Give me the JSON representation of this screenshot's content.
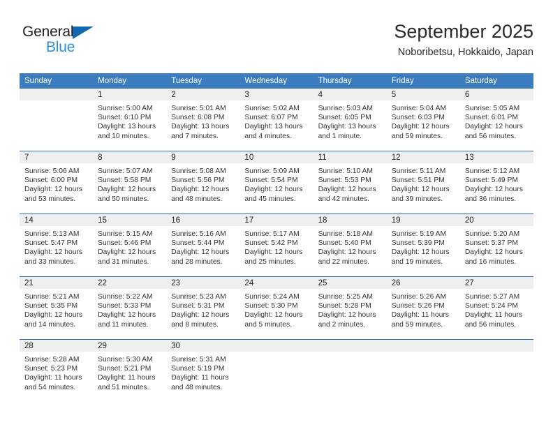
{
  "logo": {
    "word_top": "General",
    "word_bottom": "Blue",
    "triangle_color": "#1269b0",
    "bottom_color": "#2e8fd6"
  },
  "header": {
    "title": "September 2025",
    "subtitle": "Noboribetsu, Hokkaido, Japan"
  },
  "theme": {
    "header_bg": "#3a7cbd",
    "header_text": "#ffffff",
    "daynum_band_bg": "#efefef",
    "row_divider": "#2c6ca8"
  },
  "weekday_headers": [
    "Sunday",
    "Monday",
    "Tuesday",
    "Wednesday",
    "Thursday",
    "Friday",
    "Saturday"
  ],
  "weeks": [
    [
      {
        "day": "",
        "sunrise": "",
        "sunset": "",
        "daylight_l1": "",
        "daylight_l2": ""
      },
      {
        "day": "1",
        "sunrise": "Sunrise: 5:00 AM",
        "sunset": "Sunset: 6:10 PM",
        "daylight_l1": "Daylight: 13 hours",
        "daylight_l2": "and 10 minutes."
      },
      {
        "day": "2",
        "sunrise": "Sunrise: 5:01 AM",
        "sunset": "Sunset: 6:08 PM",
        "daylight_l1": "Daylight: 13 hours",
        "daylight_l2": "and 7 minutes."
      },
      {
        "day": "3",
        "sunrise": "Sunrise: 5:02 AM",
        "sunset": "Sunset: 6:07 PM",
        "daylight_l1": "Daylight: 13 hours",
        "daylight_l2": "and 4 minutes."
      },
      {
        "day": "4",
        "sunrise": "Sunrise: 5:03 AM",
        "sunset": "Sunset: 6:05 PM",
        "daylight_l1": "Daylight: 13 hours",
        "daylight_l2": "and 1 minute."
      },
      {
        "day": "5",
        "sunrise": "Sunrise: 5:04 AM",
        "sunset": "Sunset: 6:03 PM",
        "daylight_l1": "Daylight: 12 hours",
        "daylight_l2": "and 59 minutes."
      },
      {
        "day": "6",
        "sunrise": "Sunrise: 5:05 AM",
        "sunset": "Sunset: 6:01 PM",
        "daylight_l1": "Daylight: 12 hours",
        "daylight_l2": "and 56 minutes."
      }
    ],
    [
      {
        "day": "7",
        "sunrise": "Sunrise: 5:06 AM",
        "sunset": "Sunset: 6:00 PM",
        "daylight_l1": "Daylight: 12 hours",
        "daylight_l2": "and 53 minutes."
      },
      {
        "day": "8",
        "sunrise": "Sunrise: 5:07 AM",
        "sunset": "Sunset: 5:58 PM",
        "daylight_l1": "Daylight: 12 hours",
        "daylight_l2": "and 50 minutes."
      },
      {
        "day": "9",
        "sunrise": "Sunrise: 5:08 AM",
        "sunset": "Sunset: 5:56 PM",
        "daylight_l1": "Daylight: 12 hours",
        "daylight_l2": "and 48 minutes."
      },
      {
        "day": "10",
        "sunrise": "Sunrise: 5:09 AM",
        "sunset": "Sunset: 5:54 PM",
        "daylight_l1": "Daylight: 12 hours",
        "daylight_l2": "and 45 minutes."
      },
      {
        "day": "11",
        "sunrise": "Sunrise: 5:10 AM",
        "sunset": "Sunset: 5:53 PM",
        "daylight_l1": "Daylight: 12 hours",
        "daylight_l2": "and 42 minutes."
      },
      {
        "day": "12",
        "sunrise": "Sunrise: 5:11 AM",
        "sunset": "Sunset: 5:51 PM",
        "daylight_l1": "Daylight: 12 hours",
        "daylight_l2": "and 39 minutes."
      },
      {
        "day": "13",
        "sunrise": "Sunrise: 5:12 AM",
        "sunset": "Sunset: 5:49 PM",
        "daylight_l1": "Daylight: 12 hours",
        "daylight_l2": "and 36 minutes."
      }
    ],
    [
      {
        "day": "14",
        "sunrise": "Sunrise: 5:13 AM",
        "sunset": "Sunset: 5:47 PM",
        "daylight_l1": "Daylight: 12 hours",
        "daylight_l2": "and 33 minutes."
      },
      {
        "day": "15",
        "sunrise": "Sunrise: 5:15 AM",
        "sunset": "Sunset: 5:46 PM",
        "daylight_l1": "Daylight: 12 hours",
        "daylight_l2": "and 31 minutes."
      },
      {
        "day": "16",
        "sunrise": "Sunrise: 5:16 AM",
        "sunset": "Sunset: 5:44 PM",
        "daylight_l1": "Daylight: 12 hours",
        "daylight_l2": "and 28 minutes."
      },
      {
        "day": "17",
        "sunrise": "Sunrise: 5:17 AM",
        "sunset": "Sunset: 5:42 PM",
        "daylight_l1": "Daylight: 12 hours",
        "daylight_l2": "and 25 minutes."
      },
      {
        "day": "18",
        "sunrise": "Sunrise: 5:18 AM",
        "sunset": "Sunset: 5:40 PM",
        "daylight_l1": "Daylight: 12 hours",
        "daylight_l2": "and 22 minutes."
      },
      {
        "day": "19",
        "sunrise": "Sunrise: 5:19 AM",
        "sunset": "Sunset: 5:39 PM",
        "daylight_l1": "Daylight: 12 hours",
        "daylight_l2": "and 19 minutes."
      },
      {
        "day": "20",
        "sunrise": "Sunrise: 5:20 AM",
        "sunset": "Sunset: 5:37 PM",
        "daylight_l1": "Daylight: 12 hours",
        "daylight_l2": "and 16 minutes."
      }
    ],
    [
      {
        "day": "21",
        "sunrise": "Sunrise: 5:21 AM",
        "sunset": "Sunset: 5:35 PM",
        "daylight_l1": "Daylight: 12 hours",
        "daylight_l2": "and 14 minutes."
      },
      {
        "day": "22",
        "sunrise": "Sunrise: 5:22 AM",
        "sunset": "Sunset: 5:33 PM",
        "daylight_l1": "Daylight: 12 hours",
        "daylight_l2": "and 11 minutes."
      },
      {
        "day": "23",
        "sunrise": "Sunrise: 5:23 AM",
        "sunset": "Sunset: 5:31 PM",
        "daylight_l1": "Daylight: 12 hours",
        "daylight_l2": "and 8 minutes."
      },
      {
        "day": "24",
        "sunrise": "Sunrise: 5:24 AM",
        "sunset": "Sunset: 5:30 PM",
        "daylight_l1": "Daylight: 12 hours",
        "daylight_l2": "and 5 minutes."
      },
      {
        "day": "25",
        "sunrise": "Sunrise: 5:25 AM",
        "sunset": "Sunset: 5:28 PM",
        "daylight_l1": "Daylight: 12 hours",
        "daylight_l2": "and 2 minutes."
      },
      {
        "day": "26",
        "sunrise": "Sunrise: 5:26 AM",
        "sunset": "Sunset: 5:26 PM",
        "daylight_l1": "Daylight: 11 hours",
        "daylight_l2": "and 59 minutes."
      },
      {
        "day": "27",
        "sunrise": "Sunrise: 5:27 AM",
        "sunset": "Sunset: 5:24 PM",
        "daylight_l1": "Daylight: 11 hours",
        "daylight_l2": "and 56 minutes."
      }
    ],
    [
      {
        "day": "28",
        "sunrise": "Sunrise: 5:28 AM",
        "sunset": "Sunset: 5:23 PM",
        "daylight_l1": "Daylight: 11 hours",
        "daylight_l2": "and 54 minutes."
      },
      {
        "day": "29",
        "sunrise": "Sunrise: 5:30 AM",
        "sunset": "Sunset: 5:21 PM",
        "daylight_l1": "Daylight: 11 hours",
        "daylight_l2": "and 51 minutes."
      },
      {
        "day": "30",
        "sunrise": "Sunrise: 5:31 AM",
        "sunset": "Sunset: 5:19 PM",
        "daylight_l1": "Daylight: 11 hours",
        "daylight_l2": "and 48 minutes."
      },
      {
        "day": "",
        "sunrise": "",
        "sunset": "",
        "daylight_l1": "",
        "daylight_l2": ""
      },
      {
        "day": "",
        "sunrise": "",
        "sunset": "",
        "daylight_l1": "",
        "daylight_l2": ""
      },
      {
        "day": "",
        "sunrise": "",
        "sunset": "",
        "daylight_l1": "",
        "daylight_l2": ""
      },
      {
        "day": "",
        "sunrise": "",
        "sunset": "",
        "daylight_l1": "",
        "daylight_l2": ""
      }
    ]
  ]
}
